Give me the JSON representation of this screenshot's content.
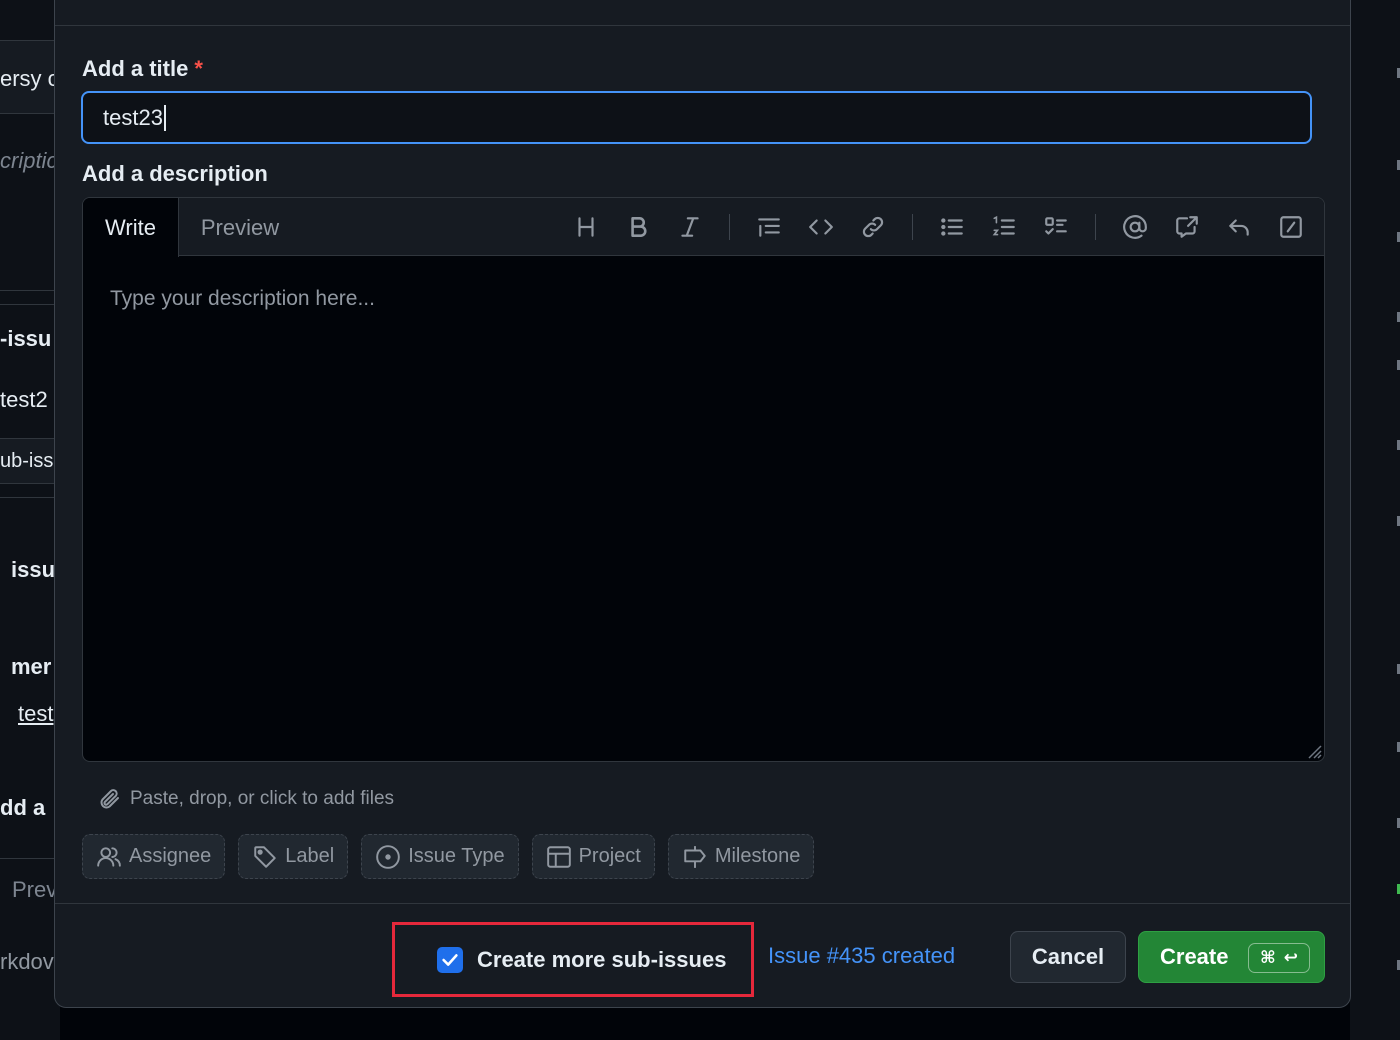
{
  "background": {
    "left_fragments": [
      "ersy c",
      "criptic",
      "-issu",
      "test2",
      "ub-iss",
      "issu",
      "mer",
      "test",
      "dd a",
      "Prev",
      "rkdov"
    ]
  },
  "dialog": {
    "title_label": "Add a title",
    "required_mark": "*",
    "title_value": "test23",
    "description_label": "Add a description",
    "tabs": {
      "write": "Write",
      "preview": "Preview"
    },
    "toolbar": [
      "heading-icon",
      "bold-icon",
      "italic-icon",
      "quote-icon",
      "code-icon",
      "link-icon",
      "unordered-list-icon",
      "ordered-list-icon",
      "task-list-icon",
      "mention-icon",
      "cross-reference-icon",
      "saved-reply-icon",
      "slash-command-icon"
    ],
    "description_placeholder": "Type your description here...",
    "attach_text": "Paste, drop, or click to add files",
    "metadata_chips": {
      "assignee": "Assignee",
      "label": "Label",
      "issue_type": "Issue Type",
      "project": "Project",
      "milestone": "Milestone"
    },
    "footer": {
      "create_more_label": "Create more sub-issues",
      "create_more_checked": true,
      "status_text": "Issue #435 created",
      "cancel_label": "Cancel",
      "create_label": "Create",
      "shortcut_cmd": "⌘",
      "shortcut_enter": "↩"
    }
  },
  "colors": {
    "accent": "#4493f8",
    "primary_button": "#238636",
    "highlight_box": "#e5283b",
    "checkbox": "#1f6feb"
  }
}
